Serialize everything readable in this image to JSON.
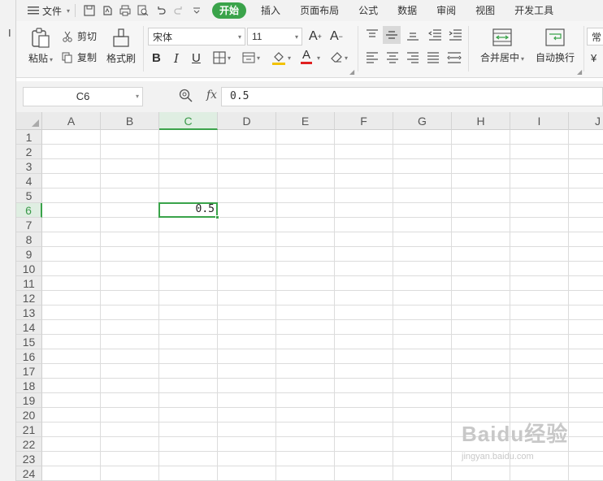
{
  "menu": {
    "file_label": "文件",
    "tabs": [
      {
        "label": "开始",
        "active": true
      },
      {
        "label": "插入"
      },
      {
        "label": "页面布局"
      },
      {
        "label": "公式"
      },
      {
        "label": "数据"
      },
      {
        "label": "审阅"
      },
      {
        "label": "视图"
      },
      {
        "label": "开发工具"
      }
    ]
  },
  "ribbon": {
    "paste_label": "粘贴",
    "cut_label": "剪切",
    "copy_label": "复制",
    "format_painter_label": "格式刷",
    "font_name": "宋体",
    "font_size": "11",
    "merge_center_label": "合并居中",
    "wrap_text_label": "自动换行",
    "number_format_partial": "常"
  },
  "formula_bar": {
    "name_box": "C6",
    "fx_label": "fx",
    "formula_value": "0.5"
  },
  "sheet": {
    "columns": [
      "A",
      "B",
      "C",
      "D",
      "E",
      "F",
      "G",
      "H",
      "I",
      "J"
    ],
    "rows": [
      "1",
      "2",
      "3",
      "4",
      "5",
      "6",
      "7",
      "8",
      "9",
      "10",
      "11",
      "12",
      "13",
      "14",
      "15",
      "16",
      "17",
      "18",
      "19",
      "20",
      "21",
      "22",
      "23",
      "24"
    ],
    "selected_column": "C",
    "selected_row": "6",
    "active_cell_value": "0.5"
  },
  "watermark": {
    "main": "Baidu经验",
    "sub": "jingyan.baidu.com"
  },
  "colors": {
    "accent": "#3aa34a"
  }
}
